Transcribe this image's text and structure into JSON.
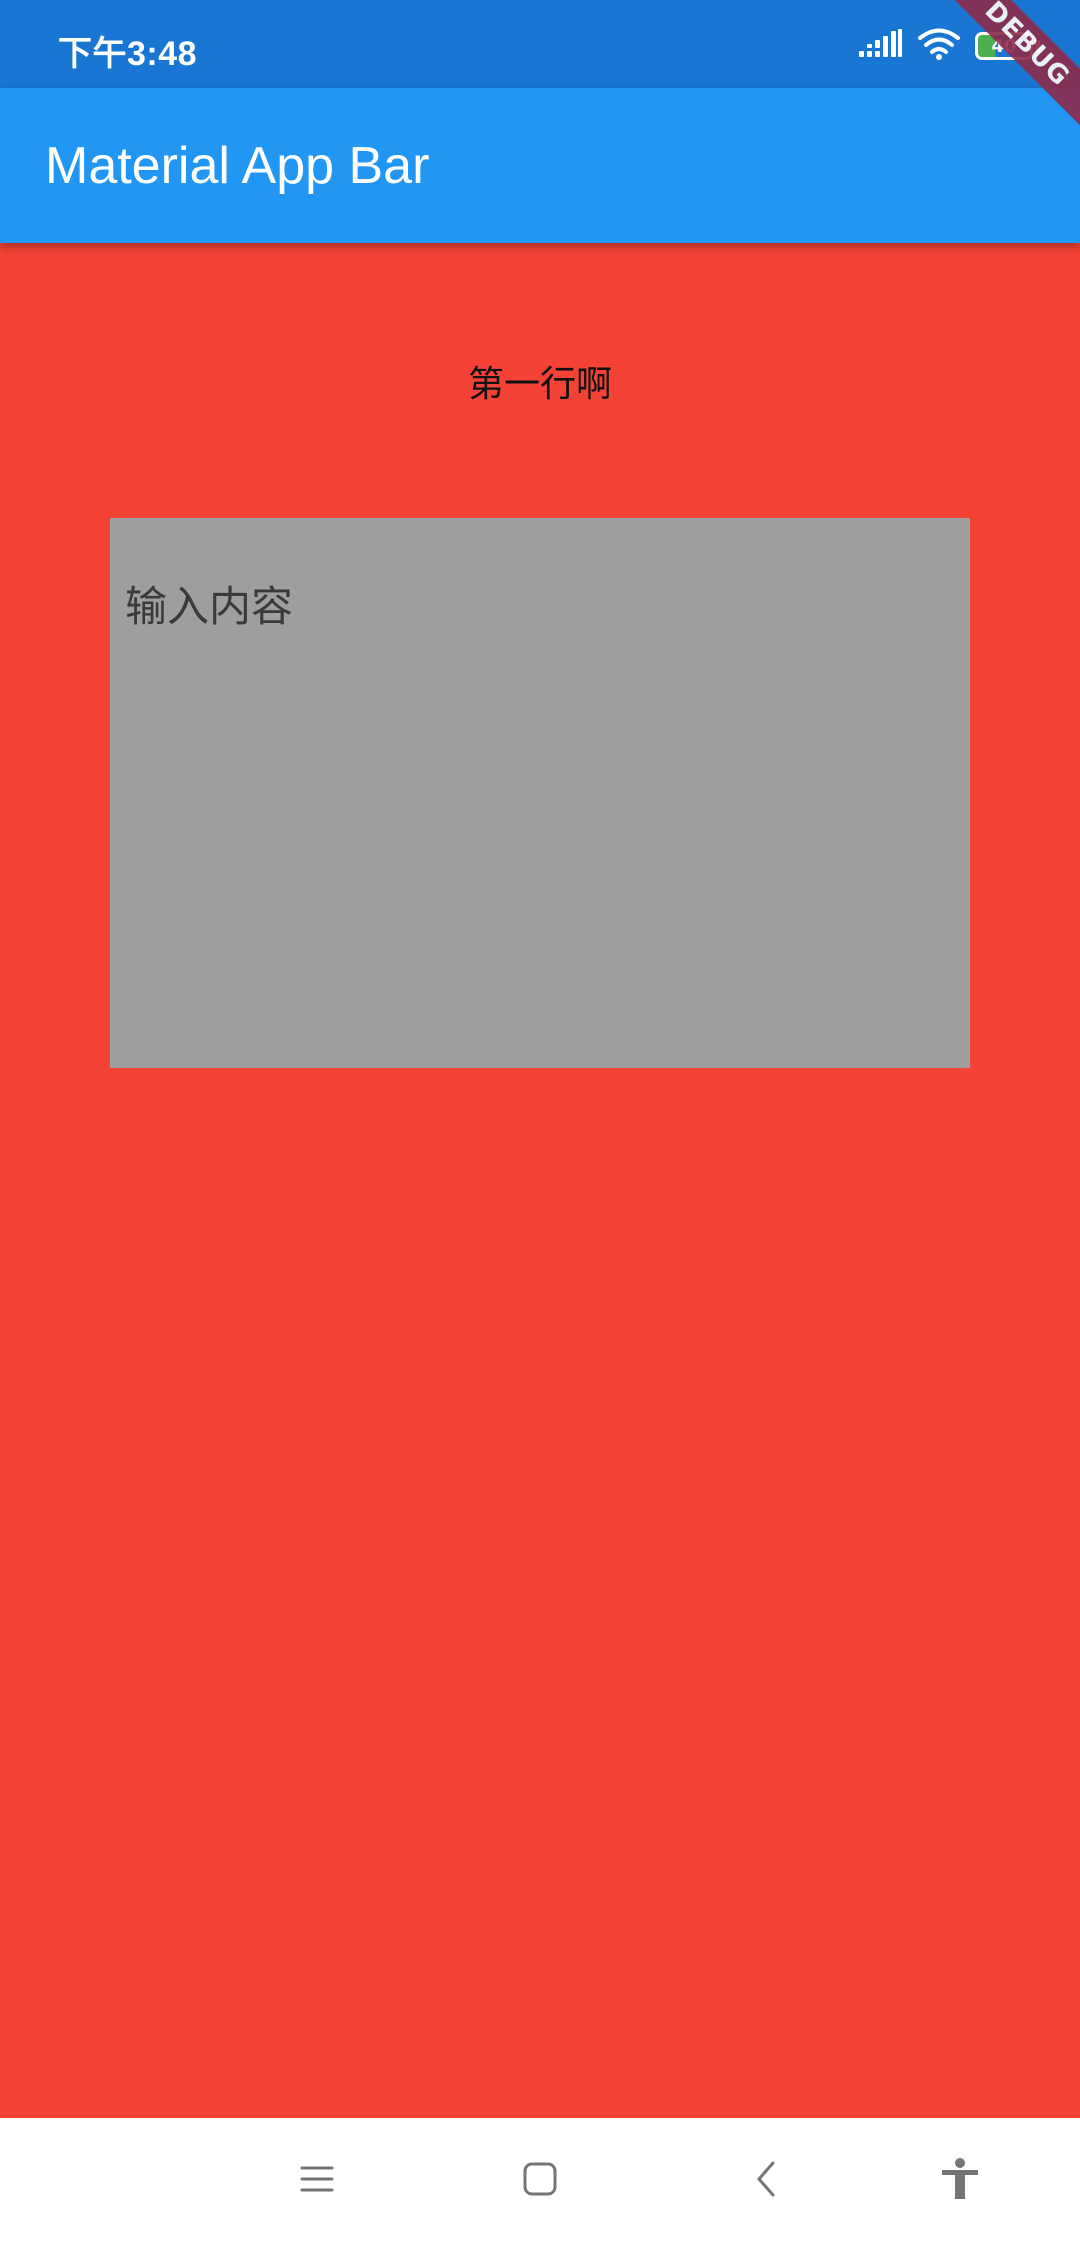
{
  "status_bar": {
    "time": "下午3:48",
    "battery_level": "40",
    "background_color": "#1976D2",
    "icons": [
      "signal-icon",
      "wifi-icon",
      "battery-icon"
    ]
  },
  "debug_banner": {
    "label": "DEBUG"
  },
  "app_bar": {
    "title": "Material App Bar",
    "color": "#2196F3"
  },
  "body": {
    "background_color": "#F44336",
    "first_line": "第一行啊",
    "text_area": {
      "placeholder": "输入内容",
      "value": "",
      "background_color": "#9E9E9E"
    }
  },
  "nav_bar": {
    "icons": [
      "menu-icon",
      "home-icon",
      "back-icon",
      "accessibility-icon"
    ]
  }
}
